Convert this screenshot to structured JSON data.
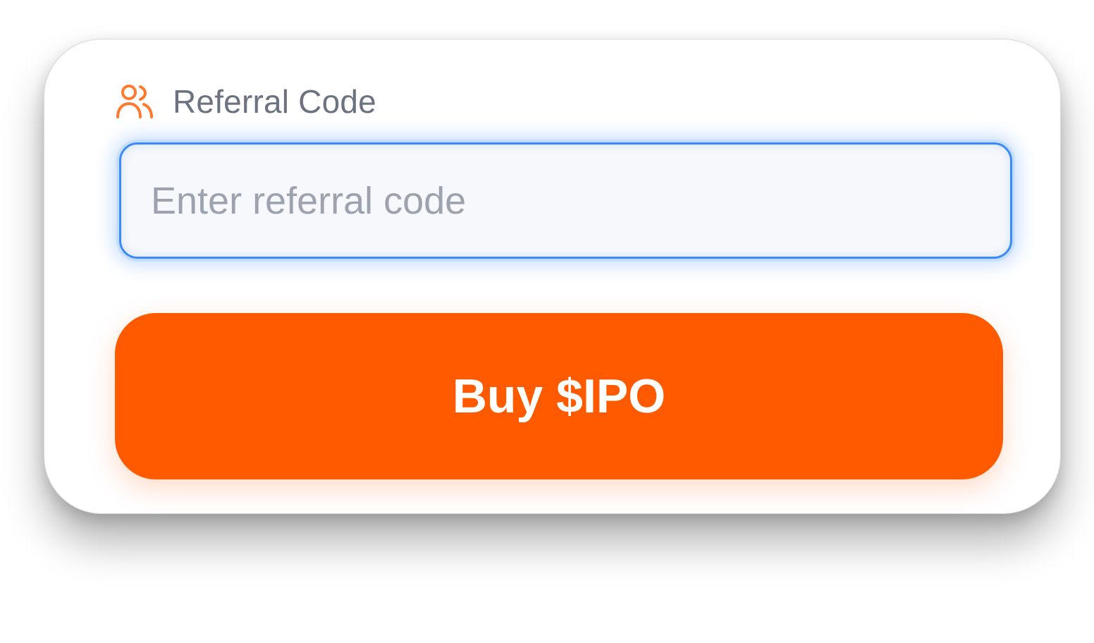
{
  "referral": {
    "label": "Referral Code",
    "icon": "users-icon",
    "placeholder": "Enter referral code",
    "value": ""
  },
  "buy_button": {
    "label": "Buy $IPO"
  },
  "colors": {
    "accent": "#ff5a00",
    "focus_border": "#3b8bf7",
    "label_text": "#6b7280",
    "placeholder_text": "#9ca3af"
  }
}
